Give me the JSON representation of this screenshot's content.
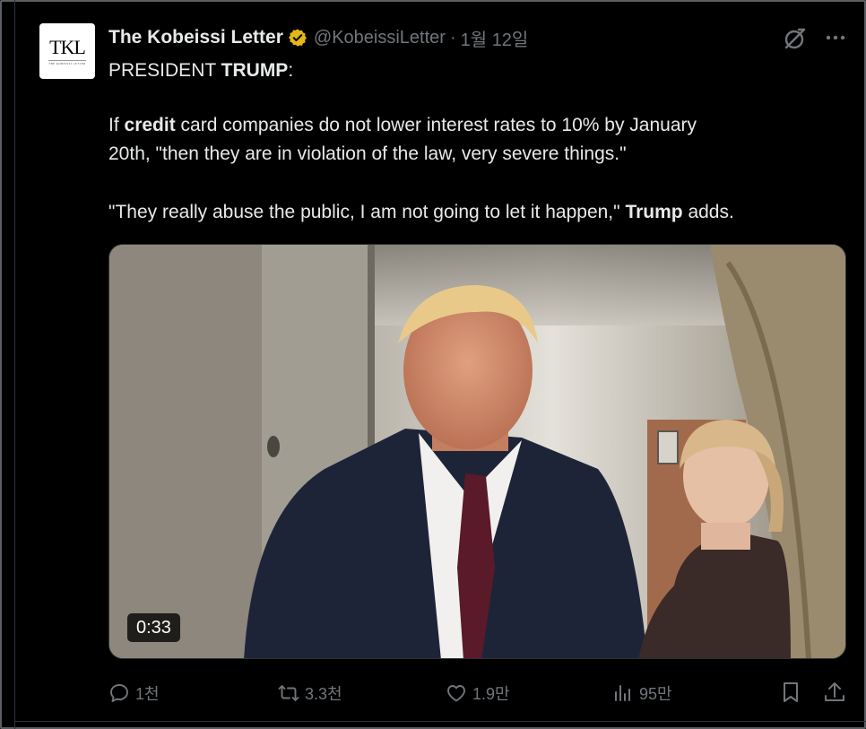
{
  "tweet": {
    "author_name": "The Kobeissi Letter",
    "author_handle": "@KobeissiLetter",
    "separator": "·",
    "date": "1월 12일",
    "avatar_monogram": "TKL",
    "avatar_subtitle": "THE KOBEISSI LETTER",
    "line1_plain": "PRESIDENT ",
    "line1_bold": "TRUMP",
    "line1_tail": ":",
    "para1_a": "If ",
    "para1_bold": "credit",
    "para1_b": " card companies do not lower interest rates to 10% by January",
    "para1_line2": "20th, \"then they are in violation of the law, very severe things.\"",
    "para2_a": "\"They really abuse the public, I am not going to let it happen,\" ",
    "para2_bold": "Trump",
    "para2_b": " adds.",
    "video_duration": "0:33"
  },
  "actions": {
    "replies": "1천",
    "reposts": "3.3천",
    "likes": "1.9만",
    "views": "95만"
  },
  "icons": {
    "verified": "verified-badge-icon",
    "grok": "grok-icon",
    "more": "more-icon",
    "reply": "reply-icon",
    "repost": "repost-icon",
    "like": "heart-icon",
    "views": "views-icon",
    "bookmark": "bookmark-icon",
    "share": "share-icon"
  },
  "colors": {
    "background": "#000000",
    "text": "#e7e9ea",
    "secondary": "#71767b",
    "verified_gold": "#e2b719"
  }
}
